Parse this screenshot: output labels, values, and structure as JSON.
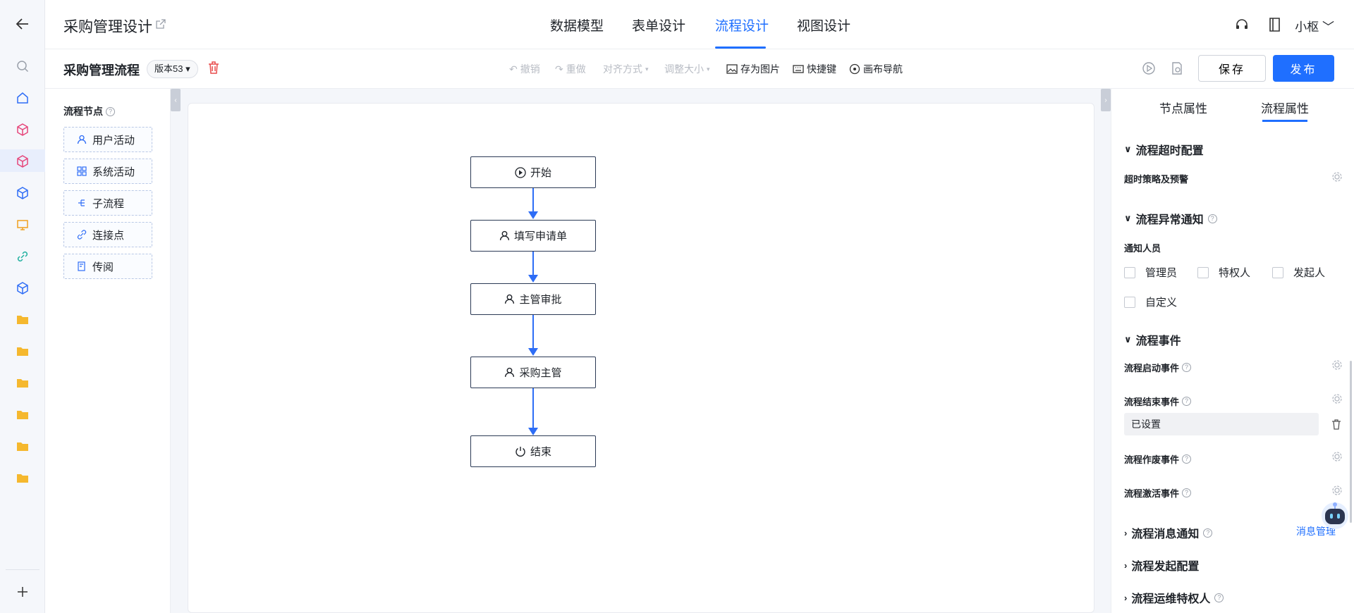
{
  "app": {
    "title": "采购管理设计"
  },
  "top_tabs": [
    {
      "label": "数据模型",
      "active": false
    },
    {
      "label": "表单设计",
      "active": false
    },
    {
      "label": "流程设计",
      "active": true
    },
    {
      "label": "视图设计",
      "active": false
    }
  ],
  "user": {
    "name": "小枢"
  },
  "toolbar": {
    "flow_title": "采购管理流程",
    "version": "版本53",
    "undo": "撤销",
    "redo": "重做",
    "align": "对齐方式",
    "resize": "调整大小",
    "save_image": "存为图片",
    "shortcuts": "快捷键",
    "canvas_nav": "画布导航",
    "save": "保存",
    "publish": "发布"
  },
  "left_panel": {
    "title": "流程节点",
    "items": [
      {
        "label": "用户活动",
        "icon": "user-icon"
      },
      {
        "label": "系统活动",
        "icon": "grid-icon"
      },
      {
        "label": "子流程",
        "icon": "subflow-icon"
      },
      {
        "label": "连接点",
        "icon": "link-icon"
      },
      {
        "label": "传阅",
        "icon": "circulate-icon"
      }
    ]
  },
  "flow_nodes": [
    {
      "label": "开始",
      "icon": "play-icon"
    },
    {
      "label": "填写申请单",
      "icon": "user-icon"
    },
    {
      "label": "主管审批",
      "icon": "user-icon"
    },
    {
      "label": "采购主管",
      "icon": "user-icon"
    },
    {
      "label": "结束",
      "icon": "power-icon"
    }
  ],
  "right_panel": {
    "tabs": [
      {
        "label": "节点属性",
        "active": false
      },
      {
        "label": "流程属性",
        "active": true
      }
    ],
    "timeout_section": "流程超时配置",
    "timeout_strategy": "超时策略及预警",
    "exception_section": "流程异常通知",
    "notify_label": "通知人员",
    "notify_options": [
      "管理员",
      "特权人",
      "发起人",
      "自定义"
    ],
    "events_section": "流程事件",
    "event_start": "流程启动事件",
    "event_end": "流程结束事件",
    "event_end_value": "已设置",
    "event_void": "流程作废事件",
    "event_activate": "流程激活事件",
    "message_section": "流程消息通知",
    "message_link": "消息管理",
    "launch_section": "流程发起配置",
    "ops_section": "流程运维特权人"
  }
}
